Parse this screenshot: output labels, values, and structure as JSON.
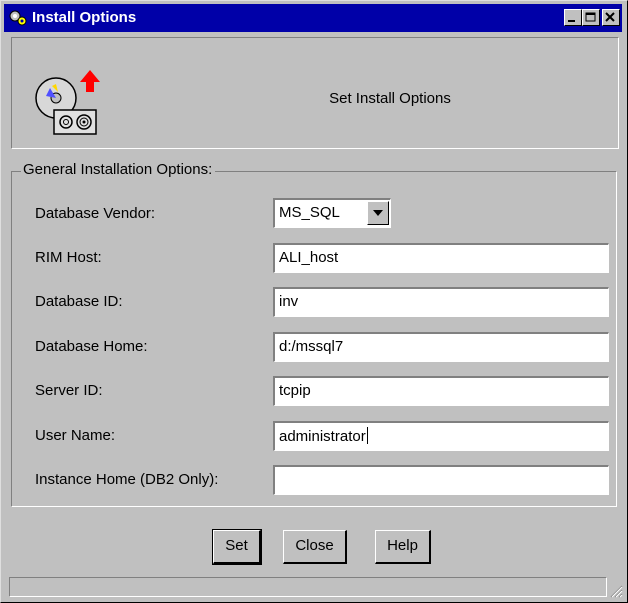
{
  "window": {
    "title": "Install Options",
    "app_icon": "gear-app-icon",
    "controls": [
      "minimize-icon",
      "maximize-icon",
      "close-icon"
    ]
  },
  "banner": {
    "icon": "cd-disk-install-icon",
    "text": "Set Install Options"
  },
  "group": {
    "label": "General Installation Options:"
  },
  "fields": {
    "database_vendor": {
      "label": "Database Vendor:",
      "value": "MS_SQL"
    },
    "rim_host": {
      "label": "RIM Host:",
      "value": "ALI_host"
    },
    "database_id": {
      "label": "Database ID:",
      "value": "inv"
    },
    "database_home": {
      "label": "Database Home:",
      "value": "d:/mssql7"
    },
    "server_id": {
      "label": "Server ID:",
      "value": "tcpip"
    },
    "user_name": {
      "label": "User Name:",
      "value": "administrator"
    },
    "instance_home": {
      "label": "Instance Home (DB2 Only):",
      "value": ""
    }
  },
  "buttons": {
    "set": "Set",
    "close": "Close",
    "help": "Help"
  },
  "colors": {
    "titlebar": "#0000a8",
    "face": "#c0c0c0"
  }
}
